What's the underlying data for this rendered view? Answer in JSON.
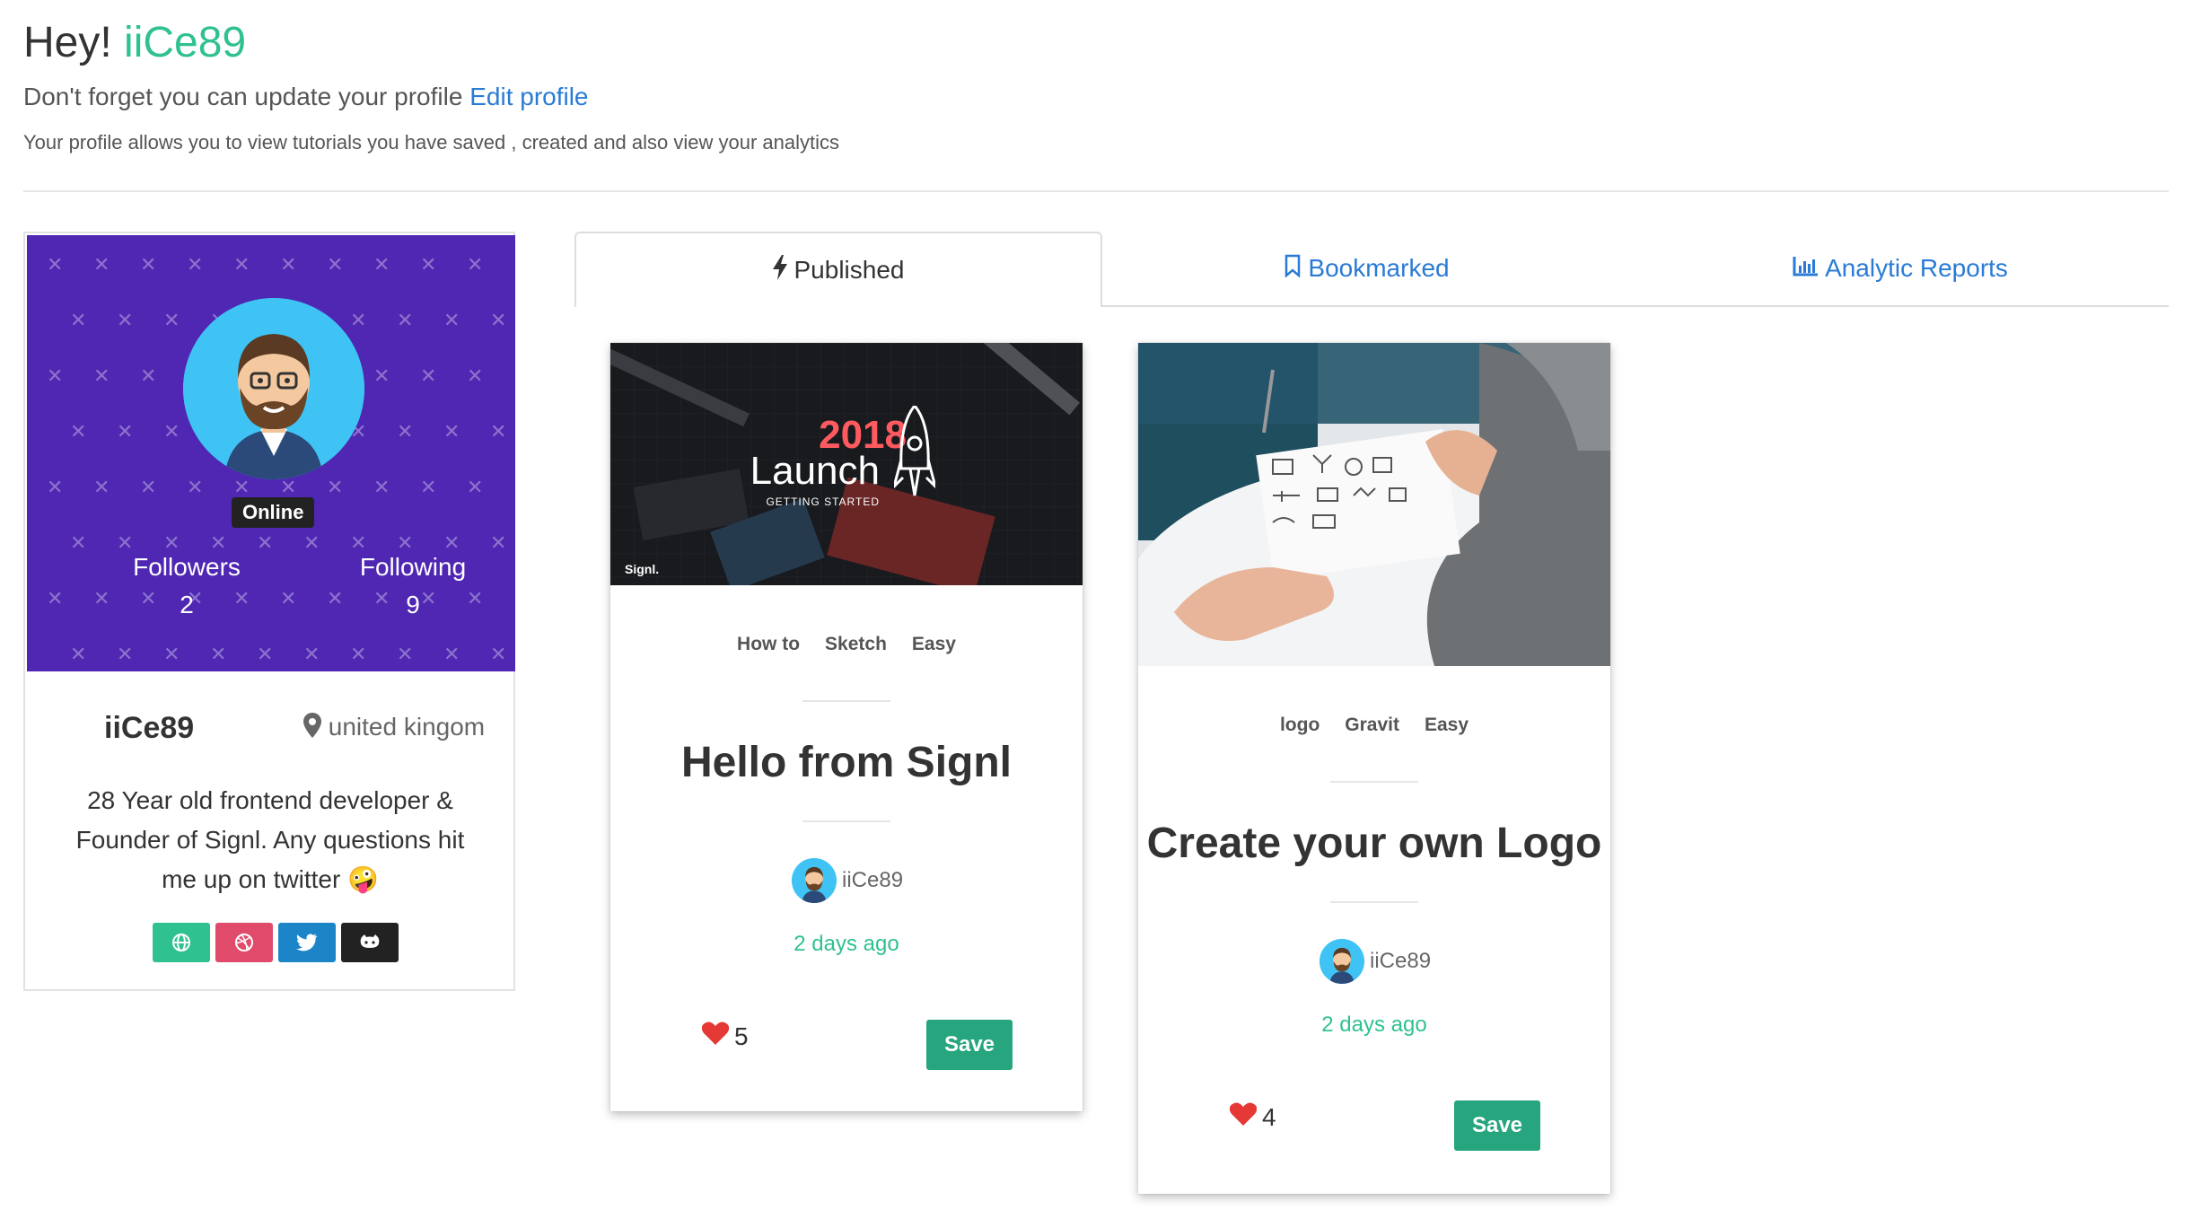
{
  "header": {
    "greeting": "Hey!",
    "username": "iiCe89",
    "update_text": "Don't forget you can update your profile",
    "edit_link": "Edit profile",
    "description": "Your profile allows you to view tutorials you have saved , created and also view your analytics"
  },
  "profile": {
    "status": "Online",
    "followers_label": "Followers",
    "followers_count": "2",
    "following_label": "Following",
    "following_count": "9",
    "username": "iiCe89",
    "location": "united kingom",
    "bio": "28 Year old frontend developer & Founder of Signl. Any questions hit me up on twitter 🤪",
    "social": [
      {
        "icon": "globe-icon",
        "color": "#2fc18f"
      },
      {
        "icon": "dribbble-icon",
        "color": "#e04a6b"
      },
      {
        "icon": "twitter-icon",
        "color": "#1b85c8"
      },
      {
        "icon": "github-icon",
        "color": "#222222"
      }
    ]
  },
  "tabs": [
    {
      "label": "Published",
      "icon": "bolt-icon",
      "active": true
    },
    {
      "label": "Bookmarked",
      "icon": "bookmark-icon",
      "active": false
    },
    {
      "label": "Analytic Reports",
      "icon": "bar-chart-icon",
      "active": false
    }
  ],
  "cards": [
    {
      "image_year": "2018",
      "image_title": "Launch",
      "image_subtitle": "GETTING STARTED",
      "image_brand": "Signl.",
      "tags": [
        "How to",
        "Sketch",
        "Easy"
      ],
      "title": "Hello from Signl",
      "author": "iiCe89",
      "time": "2 days ago",
      "likes": "5",
      "save_label": "Save"
    },
    {
      "tags": [
        "logo",
        "Gravit",
        "Easy"
      ],
      "title": "Create your own Logo",
      "author": "iiCe89",
      "time": "2 days ago",
      "likes": "4",
      "save_label": "Save"
    }
  ],
  "colors": {
    "accent": "#2fc18f",
    "link": "#2a7bd5",
    "hero": "#4f27b2",
    "save": "#26a57f",
    "heart": "#e53935"
  }
}
